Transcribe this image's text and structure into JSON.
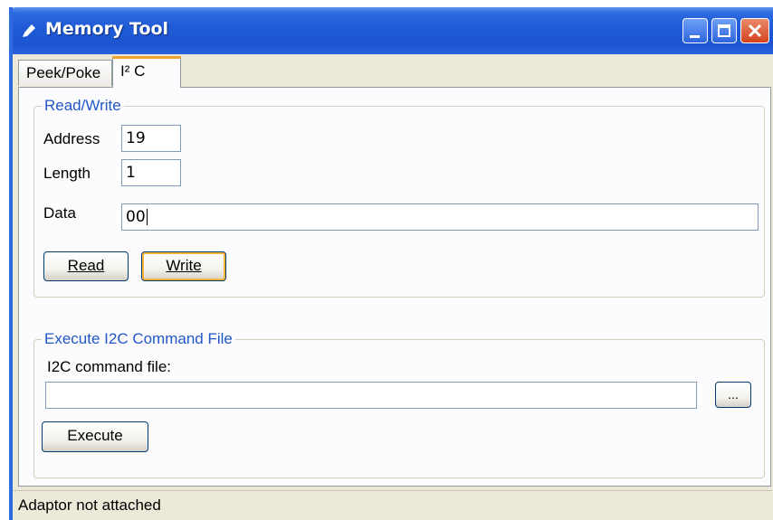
{
  "window": {
    "title": "Memory Tool",
    "icon": "pen-icon"
  },
  "tabs": [
    {
      "label": "Peek/Poke",
      "active": false
    },
    {
      "label": "I² C",
      "active": true
    }
  ],
  "read_write": {
    "legend": "Read/Write",
    "address_label": "Address",
    "address_value": "19",
    "length_label": "Length",
    "length_value": "1",
    "data_label": "Data",
    "data_value": "00",
    "read_button": "Read",
    "write_button": "Write"
  },
  "execute": {
    "legend": "Execute I2C Command File",
    "file_label": "I2C command file:",
    "file_value": "",
    "browse_button": "...",
    "execute_button": "Execute"
  },
  "status": {
    "text": "Adaptor not attached"
  },
  "colors": {
    "titlebar": "#1f5ad6",
    "legend_text": "#2157c7",
    "focus_ring": "#f8b33b",
    "close_button": "#d4421f"
  }
}
